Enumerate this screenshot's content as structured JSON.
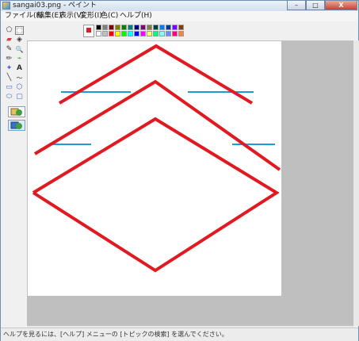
{
  "window": {
    "title": "sangai03.png - ペイント",
    "minimize_glyph": "–",
    "maximize_glyph": "□",
    "close_glyph": "X"
  },
  "menu": [
    {
      "label": "ファイル(F)"
    },
    {
      "label": "編集(E)"
    },
    {
      "label": "表示(V)"
    },
    {
      "label": "変形(I)"
    },
    {
      "label": "色(C)"
    },
    {
      "label": "ヘルプ(H)"
    }
  ],
  "tools": [
    {
      "name": "free-select-icon",
      "glyph": "⬠"
    },
    {
      "name": "rect-select-icon",
      "glyph": "⬚"
    },
    {
      "name": "eraser-icon",
      "glyph": "▰"
    },
    {
      "name": "fill-icon",
      "glyph": "◈"
    },
    {
      "name": "color-picker-icon",
      "glyph": "✎"
    },
    {
      "name": "magnifier-icon",
      "glyph": "🔍"
    },
    {
      "name": "pencil-icon",
      "glyph": "✏"
    },
    {
      "name": "brush-icon",
      "glyph": "⌁"
    },
    {
      "name": "airbrush-icon",
      "glyph": "✦"
    },
    {
      "name": "text-icon",
      "glyph": "A"
    },
    {
      "name": "line-icon",
      "glyph": "╲"
    },
    {
      "name": "curve-icon",
      "glyph": "〜"
    },
    {
      "name": "rectangle-icon",
      "glyph": "▭"
    },
    {
      "name": "polygon-icon",
      "glyph": "⬡"
    },
    {
      "name": "ellipse-icon",
      "glyph": "⬭"
    },
    {
      "name": "rounded-rect-icon",
      "glyph": "▢"
    }
  ],
  "palette": {
    "current_fg": "#e11921",
    "top_row": [
      "#000000",
      "#808080",
      "#800000",
      "#808000",
      "#008000",
      "#008080",
      "#000080",
      "#800080",
      "#808040",
      "#004040",
      "#0080ff",
      "#004080",
      "#8000ff",
      "#804000"
    ],
    "bottom_row": [
      "#ffffff",
      "#c0c0c0",
      "#ff0000",
      "#ffff00",
      "#00ff00",
      "#00ffff",
      "#0000ff",
      "#ff00ff",
      "#ffff80",
      "#00ff80",
      "#80ffff",
      "#8080ff",
      "#ff0080",
      "#ff8040"
    ]
  },
  "status": {
    "help_text": "ヘルプを見るには、[ヘルプ] メニューの [トピックの検索] を選んでください。"
  },
  "drawing": {
    "red": "#e11921",
    "blue": "#1e9bd7"
  }
}
